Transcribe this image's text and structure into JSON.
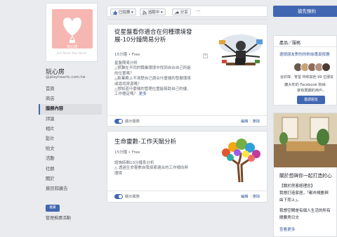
{
  "page": {
    "brand_text": "玩心房",
    "brand_tagline": "Just Share Your Heart",
    "name": "玩心房",
    "handle": "@playhearts.com.tw"
  },
  "nav": {
    "items": [
      {
        "label": "首頁",
        "active": false
      },
      {
        "label": "商店",
        "active": false
      },
      {
        "label": "服務內容",
        "active": true
      },
      {
        "label": "評論",
        "active": false
      },
      {
        "label": "相片",
        "active": false
      },
      {
        "label": "影片",
        "active": false
      },
      {
        "label": "貼文",
        "active": false
      },
      {
        "label": "活動",
        "active": false
      },
      {
        "label": "社群",
        "active": false
      },
      {
        "label": "關於",
        "active": false
      },
      {
        "label": "資訊和廣告",
        "active": false
      }
    ],
    "promote_label": "推廣",
    "manage_label": "管理推廣活動"
  },
  "action_bar": {
    "like_label": "已說讚",
    "follow_label": "追蹤中",
    "share_label": "分享",
    "more_label": "···"
  },
  "cta": {
    "label": "搶先預約"
  },
  "community": {
    "header": "產品／服務",
    "invite_link": "邀請朋友對你的粉絲專頁按讚",
    "names_line": "谷欣瑋、育瑩 林和其他 99 位朋友",
    "sub_line1": "擴大你的 Facebook 粉絲",
    "sub_line2": "家有興趣的用戶。",
    "invite_button": "邀請朋友",
    "avatar_colors": [
      "#6b5b4f",
      "#c9a27a",
      "#8a6d5a",
      "#b58f80",
      "#4c3b33"
    ]
  },
  "about": {
    "headline": "關於想與你一起打造的心",
    "line2": "【關於房客經理念】",
    "line3": "我想打造家居，「都市規劃與",
    "line4": "由下而上」。",
    "line5": "我想空間是有個人生活的所有",
    "line6": "關要房日文",
    "more_label": "查看更多"
  },
  "posts": [
    {
      "title_line1": "從星盤看你適合在何種環境發",
      "title_line2": "展-10分鐘簡易分析",
      "meta": "15分鐘 • Free",
      "desc_lines": [
        "星盤簡易分析",
        "△很難在不同的職業環境中找到自合自己所能",
        "的位置嗎？",
        "△新業務上不清楚自己適合什麼樣的發展環境",
        "或尋找資源嗎？",
        "△想知道什麼樣的管理位置能幫助自己的優、",
        "工作穩定嗎？"
      ],
      "more_label": "更多",
      "toggle_label": "顯示服務",
      "edit_label": "編輯",
      "delete_label": "刪除"
    },
    {
      "title_line1": "生命靈數-工作天賦分析",
      "meta": "15分鐘 • Free",
      "desc_lines": [
        "諮詢時間10分鐘系分析",
        "△ 透過生命靈數自我探索適合的工作傾向與",
        "環境"
      ],
      "toggle_label": "顯示服務",
      "edit_label": "編輯",
      "delete_label": "刪除"
    }
  ]
}
